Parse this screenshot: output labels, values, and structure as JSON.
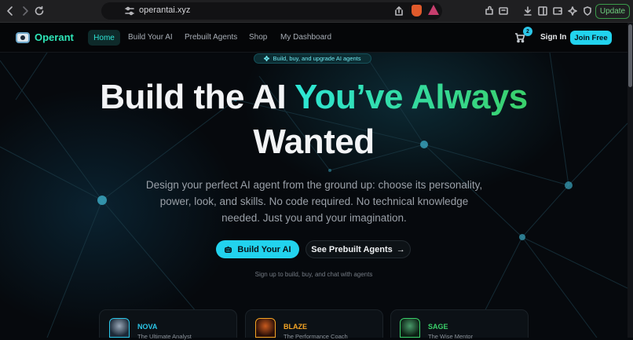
{
  "browser": {
    "url": "operantai.xyz",
    "update_label": "Update"
  },
  "nav": {
    "logo": "Operant",
    "links": [
      "Home",
      "Build Your AI",
      "Prebuilt Agents",
      "Shop",
      "My Dashboard"
    ],
    "cart_count": "2",
    "sign_in": "Sign In",
    "join": "Join Free"
  },
  "hero": {
    "pill": "Build, buy, and upgrade AI agents",
    "title_part1": "Build the AI",
    "title_highlight": "You’ve Always",
    "title_part2": "Wanted",
    "subtitle": "Design your perfect AI agent from the ground up: choose its personality, power, look, and skills. No code required. No technical knowledge needed. Just you and your imagination.",
    "cta_primary": "Build Your AI",
    "cta_secondary": "See Prebuilt Agents",
    "cta_note": "Sign up to build, buy, and chat with agents"
  },
  "agents": [
    {
      "name": "NOVA",
      "role": "The Ultimate Analyst",
      "color": "#2bc6e8"
    },
    {
      "name": "BLAZE",
      "role": "The Performance Coach",
      "color": "#f5a524"
    },
    {
      "name": "SAGE",
      "role": "The Wise Mentor",
      "color": "#3ad06a"
    }
  ]
}
